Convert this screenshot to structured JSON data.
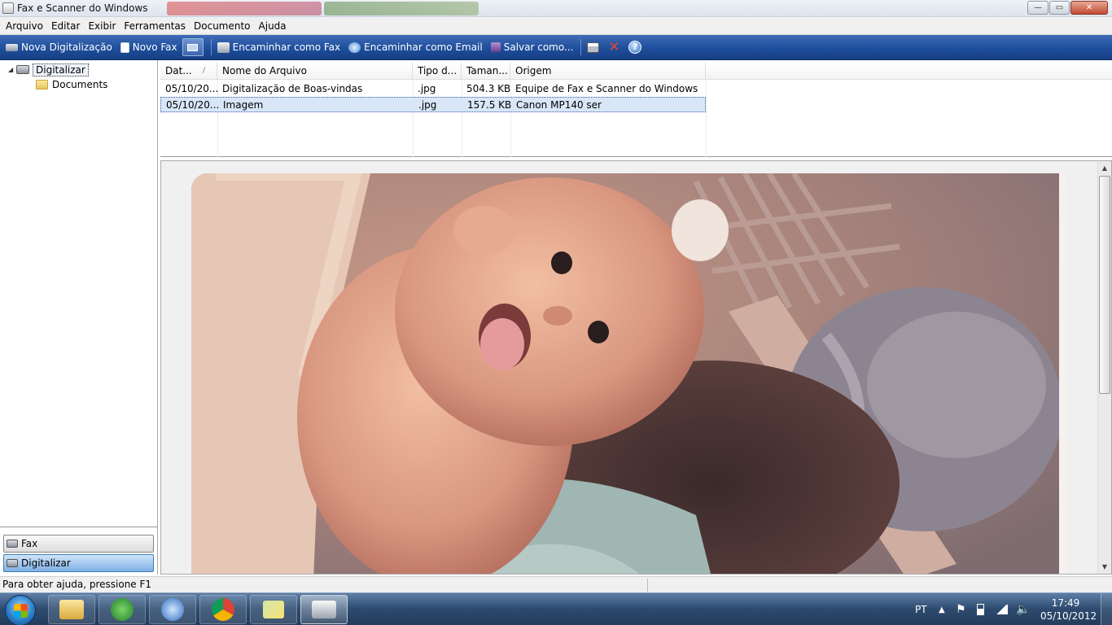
{
  "window": {
    "title": "Fax e Scanner do Windows",
    "controls": {
      "minimize": "—",
      "maximize": "▭",
      "close": "✕"
    }
  },
  "menu": [
    "Arquivo",
    "Editar",
    "Exibir",
    "Ferramentas",
    "Documento",
    "Ajuda"
  ],
  "toolbar": {
    "new_scan": "Nova Digitalização",
    "new_fax": "Novo Fax",
    "forward_fax": "Encaminhar como Fax",
    "forward_email": "Encaminhar como Email",
    "save_as": "Salvar como...",
    "icons": {
      "print": "print-icon",
      "delete": "delete-icon",
      "help": "help-icon"
    }
  },
  "tree": {
    "root": "Digitalizar",
    "child": "Documents"
  },
  "nav": {
    "fax": "Fax",
    "scan": "Digitalizar"
  },
  "filelist": {
    "columns": [
      "Dat...",
      "Nome do Arquivo",
      "Tipo d...",
      "Taman...",
      "Origem"
    ],
    "rows": [
      {
        "date": "05/10/20...",
        "name": "Digitalização de Boas-vindas",
        "type": ".jpg",
        "size": "504.3 KB",
        "origin": "Equipe de Fax e Scanner do Windows"
      },
      {
        "date": "05/10/20...",
        "name": "Imagem",
        "type": ".jpg",
        "size": "157.5 KB",
        "origin": "Canon MP140 ser"
      }
    ],
    "selected_row": 1
  },
  "preview": {
    "subject": "scanned photograph of a baby sticking out tongue"
  },
  "status": {
    "text": "Para obter ajuda, pressione F1"
  },
  "taskbar": {
    "apps": [
      "file-explorer-icon",
      "utorrent-icon",
      "itunes-icon",
      "chrome-icon",
      "folder-photos-icon",
      "fax-scanner-icon"
    ],
    "language": "PT",
    "time": "17:49",
    "date": "05/10/2012"
  },
  "colors": {
    "toolbar_blue": "#1e4e9c",
    "selection": "#d8e6f8",
    "nav_active": "#7fb0e6"
  }
}
